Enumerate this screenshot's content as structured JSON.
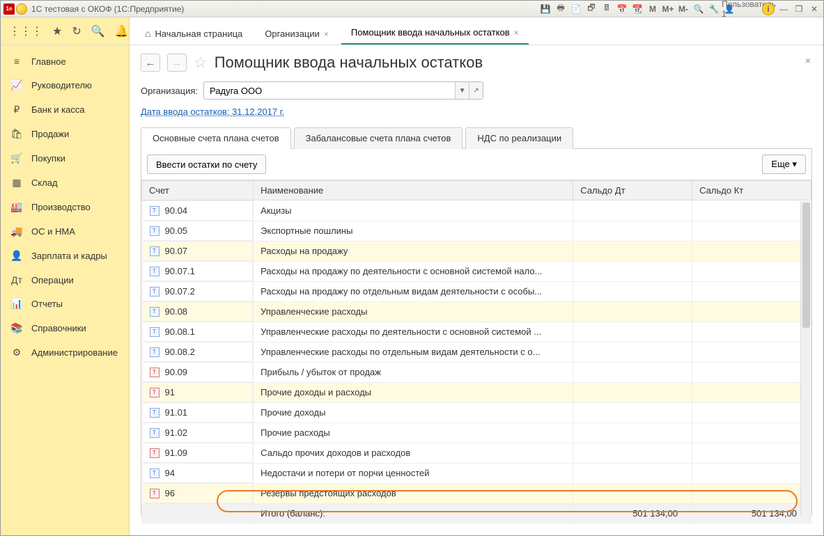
{
  "titlebar": {
    "title": "1С тестовая с ОКОФ  (1С:Предприятие)",
    "user": "Пользователь 1"
  },
  "topTabs": {
    "home": "Начальная страница",
    "org": "Организации",
    "asst": "Помощник ввода начальных остатков"
  },
  "sidebar": [
    {
      "icon": "≡",
      "label": "Главное"
    },
    {
      "icon": "📈",
      "label": "Руководителю"
    },
    {
      "icon": "₽",
      "label": "Банк и касса"
    },
    {
      "icon": "🛍",
      "label": "Продажи"
    },
    {
      "icon": "🛒",
      "label": "Покупки"
    },
    {
      "icon": "▦",
      "label": "Склад"
    },
    {
      "icon": "🏭",
      "label": "Производство"
    },
    {
      "icon": "🚚",
      "label": "ОС и НМА"
    },
    {
      "icon": "👤",
      "label": "Зарплата и кадры"
    },
    {
      "icon": "Дт",
      "label": "Операции"
    },
    {
      "icon": "📊",
      "label": "Отчеты"
    },
    {
      "icon": "📚",
      "label": "Справочники"
    },
    {
      "icon": "⚙",
      "label": "Администрирование"
    }
  ],
  "page": {
    "title": "Помощник ввода начальных остатков",
    "orgLabel": "Организация:",
    "orgValue": "Радуга ООО",
    "dateLink": "Дата ввода остатков: 31.12.2017 г.",
    "subtabs": [
      "Основные счета плана счетов",
      "Забалансовые счета плана счетов",
      "НДС по реализации"
    ],
    "enterBtn": "Ввести остатки по счету",
    "moreBtn": "Еще",
    "columns": {
      "acct": "Счет",
      "name": "Наименование",
      "dt": "Сальдо Дт",
      "kt": "Сальдо Кт"
    }
  },
  "rows": [
    {
      "hl": false,
      "ic": "b",
      "acct": "90.04",
      "name": "Акцизы"
    },
    {
      "hl": false,
      "ic": "b",
      "acct": "90.05",
      "name": "Экспортные пошлины"
    },
    {
      "hl": true,
      "ic": "b",
      "acct": "90.07",
      "name": "Расходы на продажу"
    },
    {
      "hl": false,
      "ic": "b",
      "acct": "90.07.1",
      "name": "Расходы на продажу по деятельности с основной системой нало..."
    },
    {
      "hl": false,
      "ic": "b",
      "acct": "90.07.2",
      "name": "Расходы на продажу по отдельным видам деятельности с особы..."
    },
    {
      "hl": true,
      "ic": "b",
      "acct": "90.08",
      "name": "Управленческие расходы"
    },
    {
      "hl": false,
      "ic": "b",
      "acct": "90.08.1",
      "name": "Управленческие расходы по деятельности с основной системой ..."
    },
    {
      "hl": false,
      "ic": "b",
      "acct": "90.08.2",
      "name": "Управленческие расходы по отдельным видам деятельности с о..."
    },
    {
      "hl": false,
      "ic": "r",
      "acct": "90.09",
      "name": "Прибыль / убыток от продаж"
    },
    {
      "hl": true,
      "ic": "r",
      "acct": "91",
      "name": "Прочие доходы и расходы"
    },
    {
      "hl": false,
      "ic": "b",
      "acct": "91.01",
      "name": "Прочие доходы"
    },
    {
      "hl": false,
      "ic": "b",
      "acct": "91.02",
      "name": "Прочие расходы"
    },
    {
      "hl": false,
      "ic": "r",
      "acct": "91.09",
      "name": "Сальдо прочих доходов и расходов"
    },
    {
      "hl": false,
      "ic": "b",
      "acct": "94",
      "name": "Недостачи и потери от порчи ценностей"
    },
    {
      "hl": true,
      "ic": "r",
      "acct": "96",
      "name": "Резервы предстоящих расходов"
    }
  ],
  "total": {
    "label": "Итого (баланс):",
    "dt": "501 134,00",
    "kt": "501 134,00"
  }
}
